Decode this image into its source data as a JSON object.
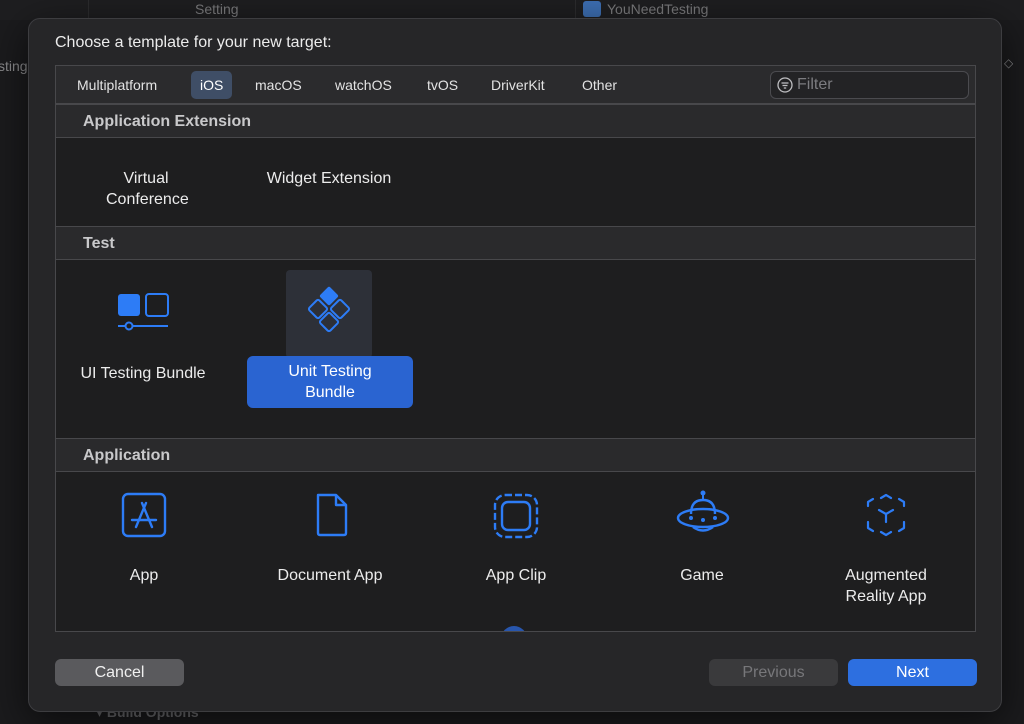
{
  "background": {
    "top_tab_left": "Setting",
    "top_tab_right": "YouNeedTesting",
    "left_fragment": "sting",
    "right_fragment": "◇",
    "bottom_fragment": "▾   Build Options"
  },
  "dialog": {
    "title": "Choose a template for your new target:",
    "tabs": [
      {
        "label": "Multiplatform",
        "active": false
      },
      {
        "label": "iOS",
        "active": true
      },
      {
        "label": "macOS",
        "active": false
      },
      {
        "label": "watchOS",
        "active": false
      },
      {
        "label": "tvOS",
        "active": false
      },
      {
        "label": "DriverKit",
        "active": false
      },
      {
        "label": "Other",
        "active": false
      }
    ],
    "filter_placeholder": "Filter",
    "sections": [
      {
        "title": "Application Extension",
        "items": [
          {
            "label": "Virtual Conference"
          },
          {
            "label": "Widget Extension"
          }
        ]
      },
      {
        "title": "Test",
        "items": [
          {
            "label": "UI Testing Bundle",
            "icon": "ui-testing-icon"
          },
          {
            "label": "Unit Testing Bundle",
            "icon": "unit-testing-icon",
            "selected": true
          }
        ]
      },
      {
        "title": "Application",
        "items": [
          {
            "label": "App",
            "icon": "app-store-icon"
          },
          {
            "label": "Document App",
            "icon": "document-icon"
          },
          {
            "label": "App Clip",
            "icon": "app-clip-icon"
          },
          {
            "label": "Game",
            "icon": "game-ufo-icon"
          },
          {
            "label": "Augmented Reality App",
            "icon": "ar-cube-icon"
          }
        ]
      }
    ],
    "buttons": {
      "cancel": "Cancel",
      "previous": "Previous",
      "next": "Next"
    },
    "accent_color": "#2d6fe0"
  }
}
